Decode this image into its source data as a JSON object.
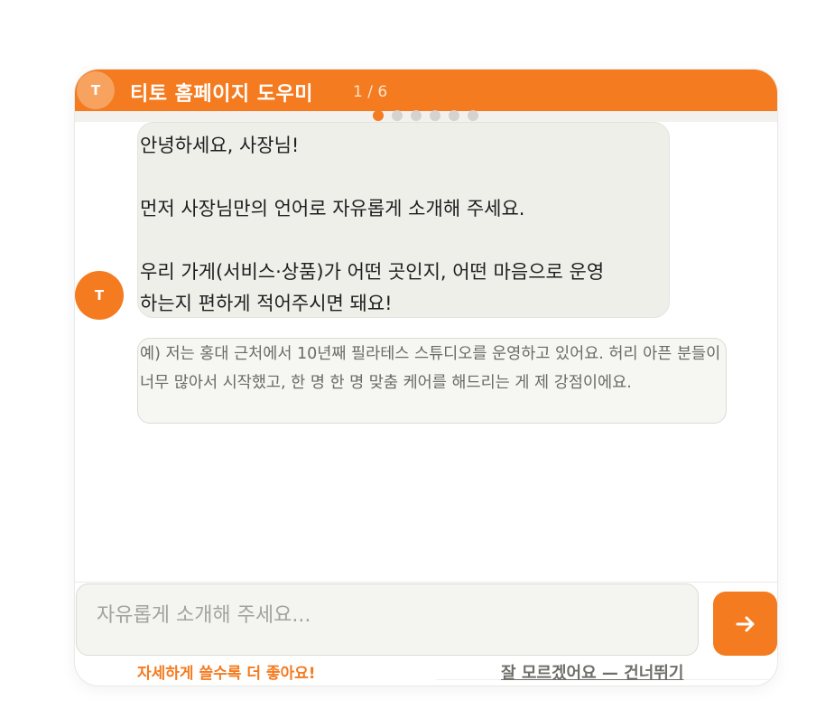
{
  "header": {
    "avatar_letter": "T",
    "title": "티토 홈페이지 도우미",
    "step_indicator": "1 / 6",
    "accent_color": "#f47b20"
  },
  "progress": {
    "total_steps": 6,
    "current_step": 1
  },
  "chat": {
    "bot_avatar_letter": "T",
    "message": "안녕하세요, 사장님!\n\n먼저 사장님만의 언어로 자유롭게 소개해 주세요.\n\n우리 가게(서비스·상품)가 어떤 곳인지, 어떤 마음으로 운영\n하는지 편하게 적어주시면 돼요!",
    "example": "예) 저는 홍대 근처에서 10년째 필라테스 스튜디오를 운영하고 있어요. 허리 아픈 분들이 너무 많아서 시작했고, 한 명 한 명 맞춤 케어를 해드리는 게 제 강점이에요."
  },
  "composer": {
    "placeholder": "자유롭게 소개해 주세요...",
    "value": "",
    "send_icon": "arrow-right-icon",
    "hint": "자세하게 쓸수록 더 좋아요!",
    "skip_label": "잘 모르겠어요 — 건너뛰기"
  }
}
